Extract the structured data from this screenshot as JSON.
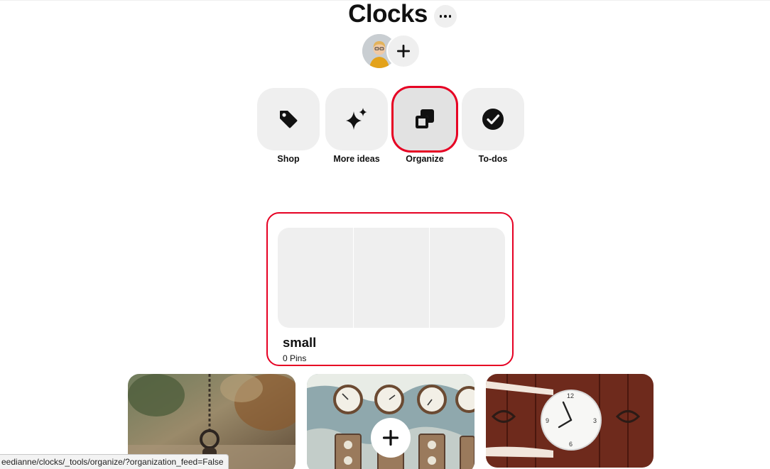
{
  "board": {
    "title": "Clocks",
    "more_icon": "ellipsis-icon",
    "add_collaborator_icon": "plus-icon"
  },
  "tools": [
    {
      "label": "Shop",
      "icon": "tag-icon",
      "active": false
    },
    {
      "label": "More ideas",
      "icon": "sparkle-icon",
      "active": false
    },
    {
      "label": "Organize",
      "icon": "organize-icon",
      "active": true
    },
    {
      "label": "To-dos",
      "icon": "checkmark-circle-icon",
      "active": false
    }
  ],
  "section": {
    "name": "small",
    "count": "0 Pins"
  },
  "pins": [
    {
      "subject": "hanging pocket watch on chain"
    },
    {
      "subject": "vintage pressure gauges on peeling wall"
    },
    {
      "subject": "hands holding white wall clock"
    }
  ],
  "status_bar": {
    "url": "eedianne/clocks/_tools/organize/?organization_feed=False"
  },
  "colors": {
    "highlight": "#e60023",
    "tile": "#efefef",
    "text": "#111111"
  }
}
